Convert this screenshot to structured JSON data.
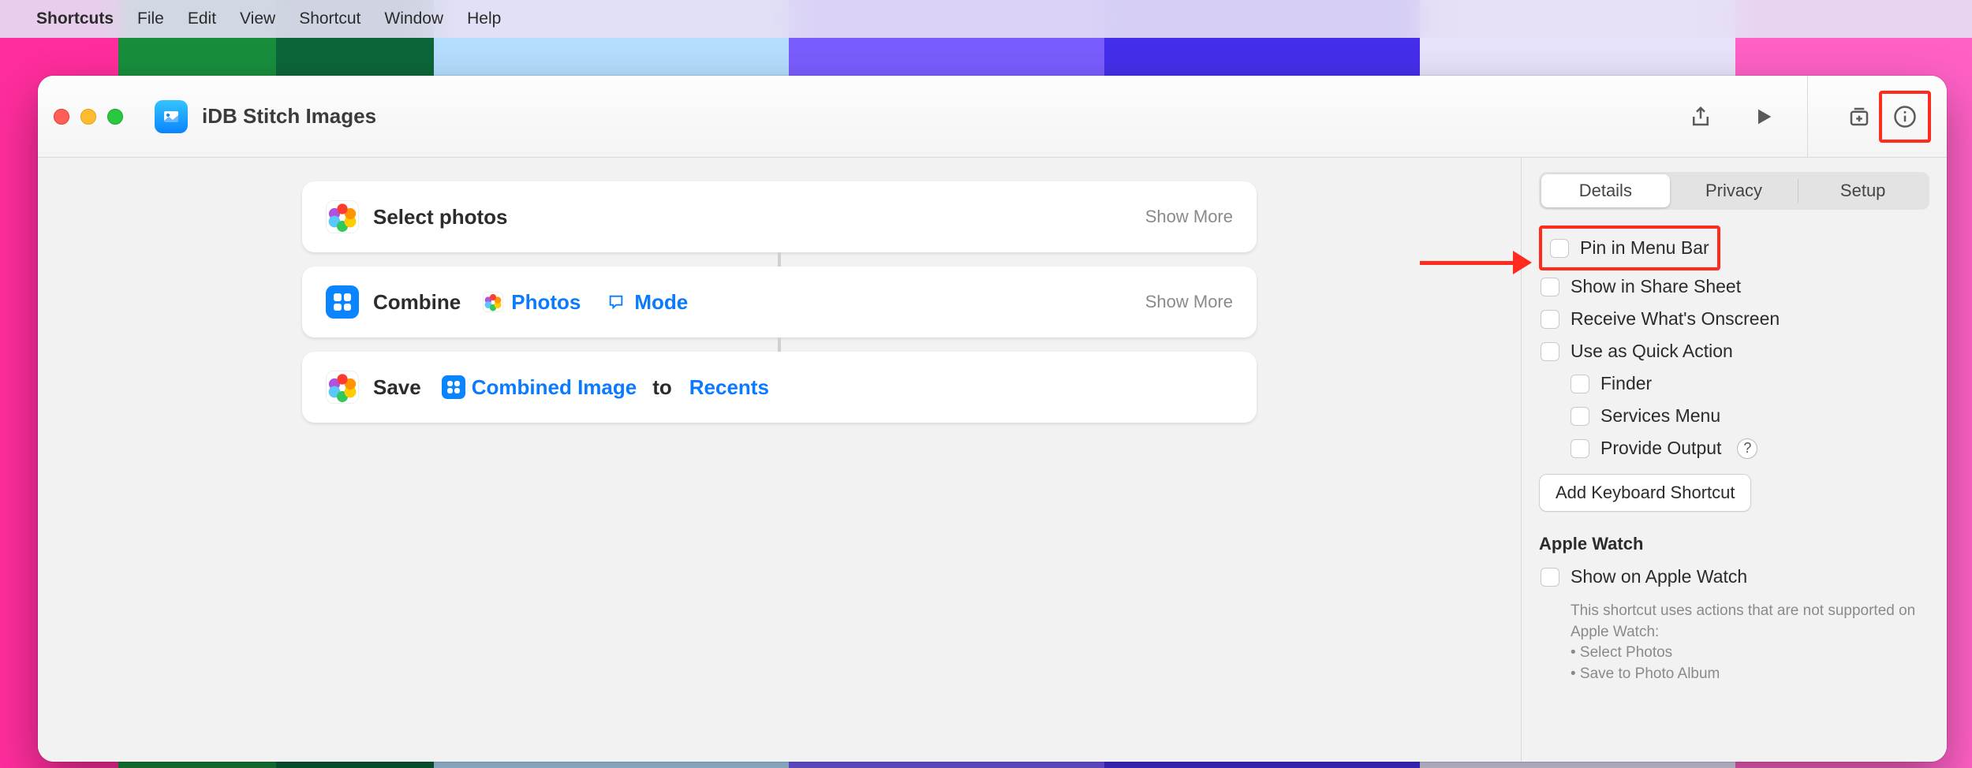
{
  "menubar": {
    "app": "Shortcuts",
    "items": [
      "File",
      "Edit",
      "View",
      "Shortcut",
      "Window",
      "Help"
    ]
  },
  "window": {
    "title": "iDB Stitch Images"
  },
  "actions": {
    "select": {
      "label": "Select photos",
      "show_more": "Show More"
    },
    "combine": {
      "label": "Combine",
      "token_photos": "Photos",
      "token_mode": "Mode",
      "show_more": "Show More"
    },
    "save": {
      "label": "Save",
      "token_combined": "Combined Image",
      "to": "to",
      "token_recents": "Recents"
    }
  },
  "inspector": {
    "tabs": {
      "details": "Details",
      "privacy": "Privacy",
      "setup": "Setup"
    },
    "pin": "Pin in Menu Bar",
    "share_sheet": "Show in Share Sheet",
    "receive": "Receive What's Onscreen",
    "quick_action": "Use as Quick Action",
    "finder": "Finder",
    "services": "Services Menu",
    "provide_output": "Provide Output",
    "add_shortcut_btn": "Add Keyboard Shortcut",
    "apple_watch_section": "Apple Watch",
    "show_on_watch": "Show on Apple Watch",
    "watch_note": "This shortcut uses actions that are not supported on Apple Watch:",
    "watch_bullet1": "• Select Photos",
    "watch_bullet2": "• Save to Photo Album"
  }
}
